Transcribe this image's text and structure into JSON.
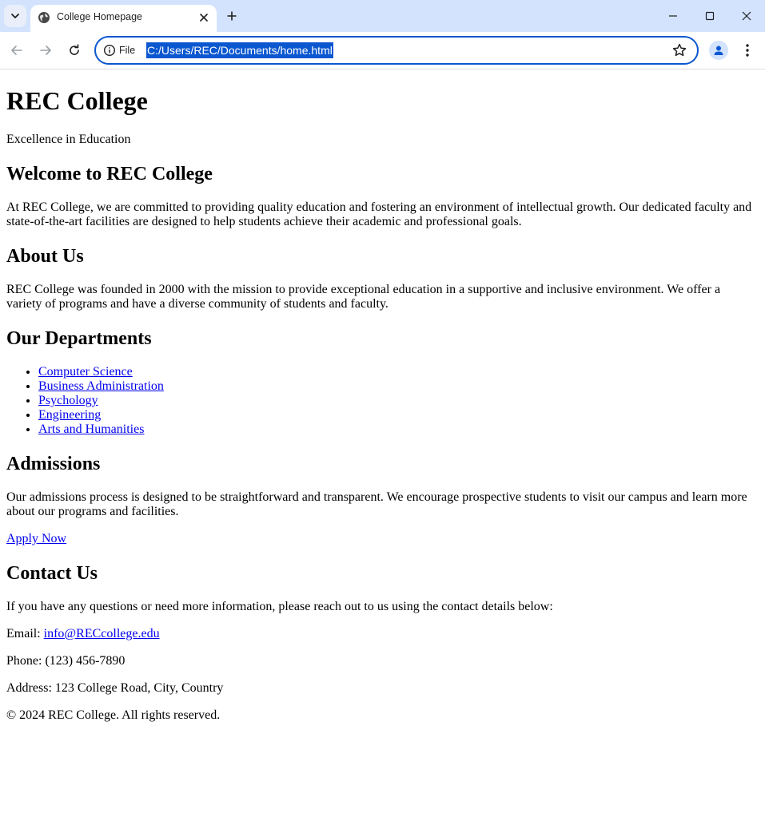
{
  "browser": {
    "tab_title": "College Homepage",
    "omnibox_scheme_label": "File",
    "url": "C:/Users/REC/Documents/home.html",
    "accent_color": "#0b57d0",
    "tabbar_color": "#d3e3fd",
    "icons": [
      "tab-list-icon",
      "globe-icon",
      "close-icon",
      "plus-icon",
      "minimize-icon",
      "maximize-icon",
      "window-close-icon",
      "back-icon",
      "forward-icon",
      "reload-icon",
      "info-icon",
      "star-icon",
      "profile-icon",
      "more-vert-icon"
    ]
  },
  "page": {
    "site_title": "REC College",
    "tagline": "Excellence in Education",
    "welcome": {
      "heading": "Welcome to REC College",
      "text": "At REC College, we are committed to providing quality education and fostering an environment of intellectual growth. Our dedicated faculty and state-of-the-art facilities are designed to help students achieve their academic and professional goals."
    },
    "about": {
      "heading": "About Us",
      "text": "REC College was founded in 2000 with the mission to provide exceptional education in a supportive and inclusive environment. We offer a variety of programs and have a diverse community of students and faculty."
    },
    "departments": {
      "heading": "Our Departments",
      "items": [
        {
          "label": "Computer Science"
        },
        {
          "label": "Business Administration"
        },
        {
          "label": "Psychology"
        },
        {
          "label": "Engineering"
        },
        {
          "label": "Arts and Humanities"
        }
      ]
    },
    "admissions": {
      "heading": "Admissions",
      "text": "Our admissions process is designed to be straightforward and transparent. We encourage prospective students to visit our campus and learn more about our programs and facilities.",
      "apply_link": "Apply Now"
    },
    "contact": {
      "heading": "Contact Us",
      "intro": "If you have any questions or need more information, please reach out to us using the contact details below:",
      "email_label": "Email: ",
      "email": "info@RECcollege.edu",
      "phone": "Phone: (123) 456-7890",
      "address": "Address: 123 College Road, City, Country"
    },
    "footer": "© 2024 REC College. All rights reserved.",
    "link_color": "#0000ee"
  }
}
